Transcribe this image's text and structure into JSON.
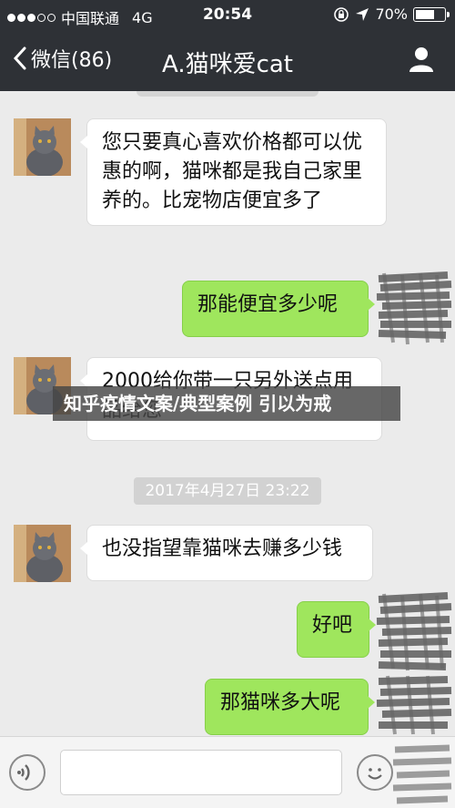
{
  "status_bar": {
    "carrier": "中国联通",
    "network": "4G",
    "time": "20:54",
    "battery": "70%",
    "battery_level": 0.7
  },
  "nav": {
    "back_label": "微信(86)",
    "title": "A.猫咪爱cat"
  },
  "messages": [
    {
      "side": "in",
      "text": "您只要真心喜欢价格都可以优惠的啊，猫咪都是我自己家里养的。比宠物店便宜多了"
    },
    {
      "side": "out",
      "text": "那能便宜多少呢"
    },
    {
      "side": "in",
      "text": "2000给你带一只另外送点用品给您"
    },
    {
      "side": "in",
      "text": "也没指望靠猫咪去赚多少钱"
    },
    {
      "side": "out",
      "text": "好吧"
    },
    {
      "side": "out",
      "text": "那猫咪多大呢"
    }
  ],
  "timestamp": "2017年4月27日 23:22",
  "watermark": "知乎疫情文案/典型案例 引以为戒",
  "icons": [
    "back-chevron-icon",
    "profile-icon",
    "voice-icon",
    "emoji-icon",
    "signal-dots-icon",
    "battery-icon"
  ],
  "colors": {
    "nav_bg": "#2e3136",
    "out_bubble": "#9fe65d",
    "chat_bg": "#ebebeb"
  }
}
